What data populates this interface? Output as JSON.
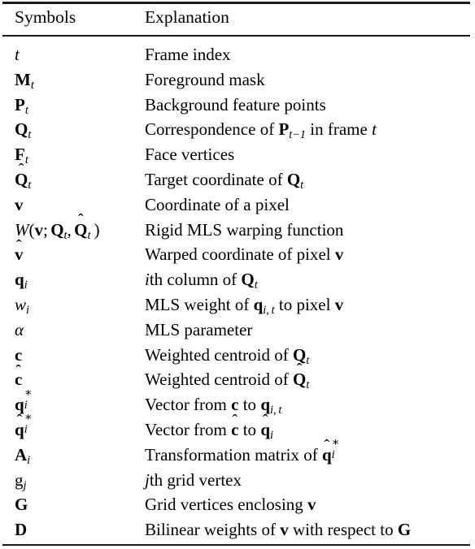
{
  "table": {
    "style": "booktabs",
    "rule_color": "#1a1a1a",
    "columns": [
      {
        "key": "symbol",
        "label": "Symbols"
      },
      {
        "key": "explanation",
        "label": "Explanation"
      }
    ],
    "rows": [
      {
        "symbol": "t",
        "explanation": "Frame index"
      },
      {
        "symbol": "M_t",
        "explanation": "Foreground mask"
      },
      {
        "symbol": "P_t",
        "explanation": "Background feature points"
      },
      {
        "symbol": "Q_t",
        "explanation": "Correspondence of P_{t-1} in frame t"
      },
      {
        "symbol": "F_t",
        "explanation": "Face vertices"
      },
      {
        "symbol": "Qhat_t",
        "explanation": "Target coordinate of Q_t"
      },
      {
        "symbol": "v",
        "explanation": "Coordinate of a pixel"
      },
      {
        "symbol": "W(v; Q_t, Qhat_t)",
        "explanation": "Rigid MLS warping function"
      },
      {
        "symbol": "vhat",
        "explanation": "Warped coordinate of pixel v"
      },
      {
        "symbol": "q_i",
        "explanation": "ith column of Q_t"
      },
      {
        "symbol": "w_i",
        "explanation": "MLS weight of q_{i,t} to pixel v"
      },
      {
        "symbol": "alpha",
        "explanation": "MLS parameter"
      },
      {
        "symbol": "c",
        "explanation": "Weighted centroid of Q_t"
      },
      {
        "symbol": "chat",
        "explanation": "Weighted centroid of Qhat_t"
      },
      {
        "symbol": "q*_i",
        "explanation": "Vector from c to q_{i,t}"
      },
      {
        "symbol": "qhat*_i",
        "explanation": "Vector from chat to qhat_i"
      },
      {
        "symbol": "A_i",
        "explanation": "Transformation matrix of qhat*_i"
      },
      {
        "symbol": "g_j",
        "explanation": "jth grid vertex"
      },
      {
        "symbol": "G",
        "explanation": "Grid vertices enclosing v"
      },
      {
        "symbol": "D",
        "explanation": "Bilinear weights of v with respect to G"
      }
    ]
  }
}
